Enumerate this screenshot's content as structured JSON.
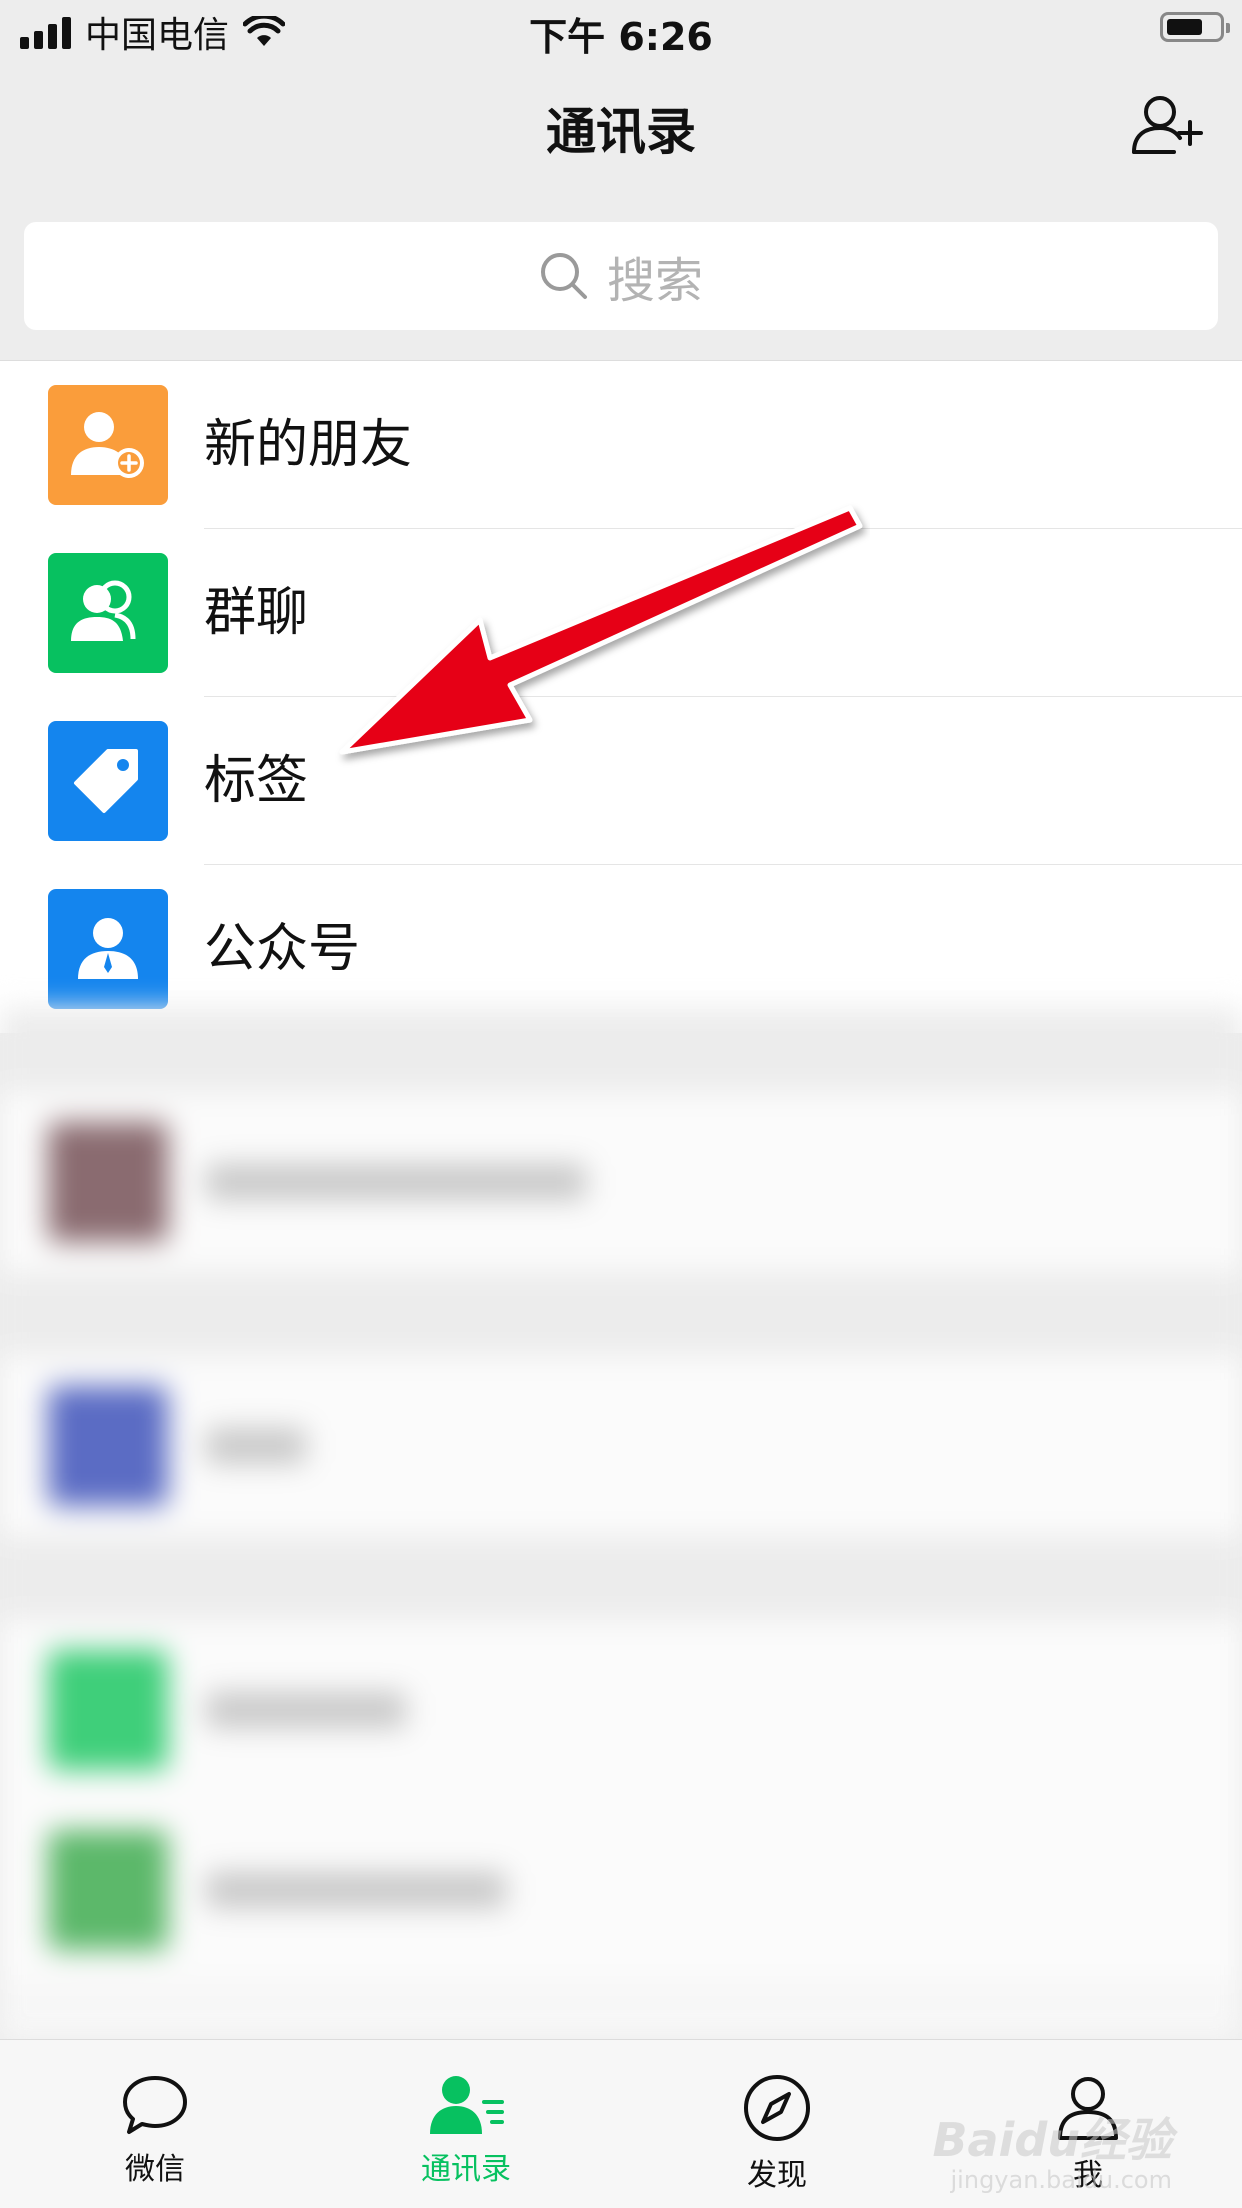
{
  "status_bar": {
    "carrier": "中国电信",
    "time": "下午 6:26",
    "battery_level": 0.7
  },
  "nav": {
    "title": "通讯录",
    "add_icon": "add-contact-icon"
  },
  "search": {
    "placeholder": "搜索"
  },
  "list": {
    "items": [
      {
        "label": "新的朋友",
        "icon": "new-friend-icon",
        "color": "#fa9d3b"
      },
      {
        "label": "群聊",
        "icon": "group-chat-icon",
        "color": "#07c160"
      },
      {
        "label": "标签",
        "icon": "tag-icon",
        "color": "#1485ee"
      },
      {
        "label": "公众号",
        "icon": "official-account-icon",
        "color": "#1485ee"
      }
    ]
  },
  "tabs": [
    {
      "label": "微信",
      "icon": "chat-bubble-icon",
      "active": false
    },
    {
      "label": "通讯录",
      "icon": "contacts-icon",
      "active": true
    },
    {
      "label": "发现",
      "icon": "compass-icon",
      "active": false
    },
    {
      "label": "我",
      "icon": "person-icon",
      "active": false
    }
  ],
  "colors": {
    "accent": "#07c160",
    "arrow": "#e60012"
  },
  "watermark": {
    "text": "Baidu经验",
    "sub": "jingyan.baidu.com"
  }
}
